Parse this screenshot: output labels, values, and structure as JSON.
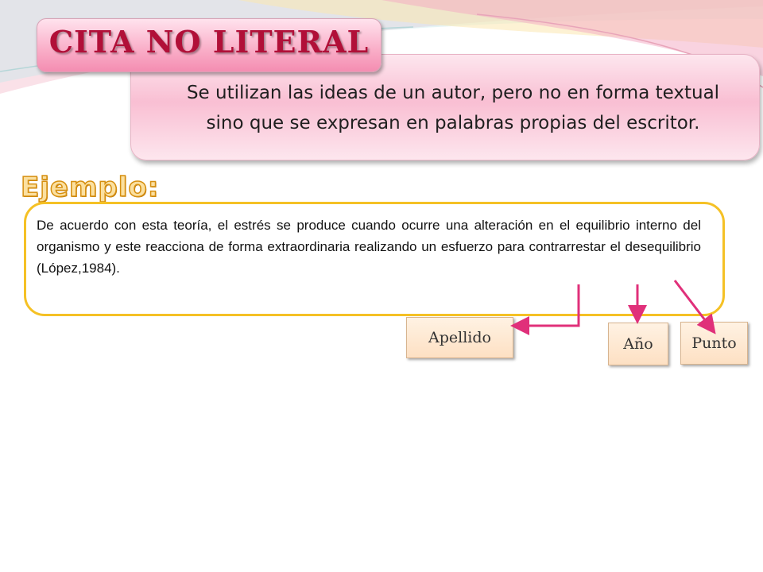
{
  "slide": {
    "title": "CITA NO LITERAL",
    "definition_line1": "Se utilizan las ideas de un autor, pero no en forma textual",
    "definition_line2": "sino que se expresan en palabras propias del escritor.",
    "example_heading": "Ejemplo:",
    "example_text": "De acuerdo con esta teoría, el estrés se produce cuando ocurre una alteración en el equilibrio interno del organismo y este reacciona de forma extraordinaria realizando un esfuerzo para contrarrestar el desequilibrio (López,1984).",
    "labels": {
      "apellido": "Apellido",
      "anio": "Año",
      "punto": "Punto"
    }
  },
  "colors": {
    "title_text": "#b10f38",
    "example_border": "#f5c125",
    "arrow": "#e0307a"
  }
}
